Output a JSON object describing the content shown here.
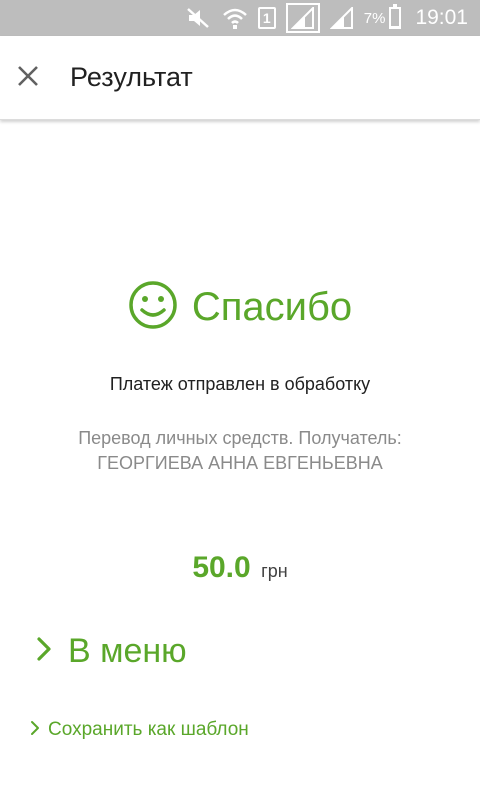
{
  "status_bar": {
    "sim_slot": "1",
    "battery_percent": "7%",
    "battery_level": 0.07,
    "time": "19:01",
    "icons": [
      "mute-icon",
      "wifi-icon",
      "sim-1-icon",
      "signal-icon",
      "signal-icon-2",
      "battery-icon"
    ]
  },
  "app_bar": {
    "close_icon": "close-icon",
    "title": "Результат"
  },
  "result": {
    "icon": "smile-icon",
    "thanks": "Спасибо",
    "status_message": "Платеж отправлен в обработку",
    "description_line1": "Перевод личных средств. Получатель:",
    "description_line2": "ГЕОРГИЕВА АННА ЕВГЕНЬЕВНА",
    "amount": "50.0",
    "currency": "грн"
  },
  "actions": {
    "menu_label": "В меню",
    "save_template_label": "Сохранить как шаблон"
  },
  "colors": {
    "accent_green": "#5aa72a",
    "status_bar_bg": "#bdbdbd",
    "text_primary": "#212121",
    "text_secondary": "#8a8a8a"
  }
}
